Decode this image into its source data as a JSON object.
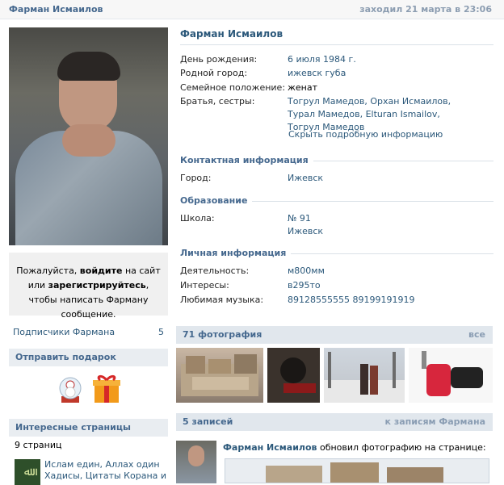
{
  "topbar": {
    "name": "Фарман Исмаилов",
    "last_seen": "заходил 21 марта в 23:06"
  },
  "message_box": {
    "part1": "Пожалуйста, ",
    "login": "войдите",
    "part2": " на сайт или ",
    "register": "зарегистрируйтесь",
    "part3": ", чтобы написать Фарману сообщение."
  },
  "subscribers": {
    "label": "Подписчики Фармана",
    "count": "5"
  },
  "gifts": {
    "title": "Отправить подарок"
  },
  "interesting": {
    "title": "Интересные страницы",
    "count": "9 страниц",
    "items": [
      {
        "line1": "Ислам един, Аллах один",
        "line2": "Хадисы, Цитаты Корана и"
      }
    ]
  },
  "profile": {
    "name": "Фарман Исмаилов",
    "rows": [
      {
        "key": "День рождения:",
        "value": "6 июля 1984 г."
      },
      {
        "key": "Родной город:",
        "value": "ижевск губа"
      },
      {
        "key": "Семейное положение:",
        "value": "женат"
      },
      {
        "key": "Братья, сестры:",
        "value": "Тогрул Мамедов, Орхан Исмаилов, Турал Мамедов, Elturan Ismailov, Тогрул Мамедов"
      }
    ],
    "hide_link": "Скрыть подробную информацию",
    "contact": {
      "title": "Контактная информация",
      "city_key": "Город:",
      "city_value": "Ижевск"
    },
    "education": {
      "title": "Образование",
      "school_key": "Школа:",
      "school_value1": "№ 91",
      "school_value2": "Ижевск"
    },
    "personal": {
      "title": "Личная информация",
      "rows": [
        {
          "key": "Деятельность:",
          "value": "м800мм"
        },
        {
          "key": "Интересы:",
          "value": "в295то"
        },
        {
          "key": "Любимая музыка:",
          "value": "89128555555 89199191919"
        }
      ]
    }
  },
  "photos": {
    "title": "71 фотография",
    "all": "все"
  },
  "wall": {
    "title": "5 записей",
    "link": "к записям Фармана",
    "author": "Фарман Исмаилов",
    "action": " обновил фотографию на странице:"
  }
}
